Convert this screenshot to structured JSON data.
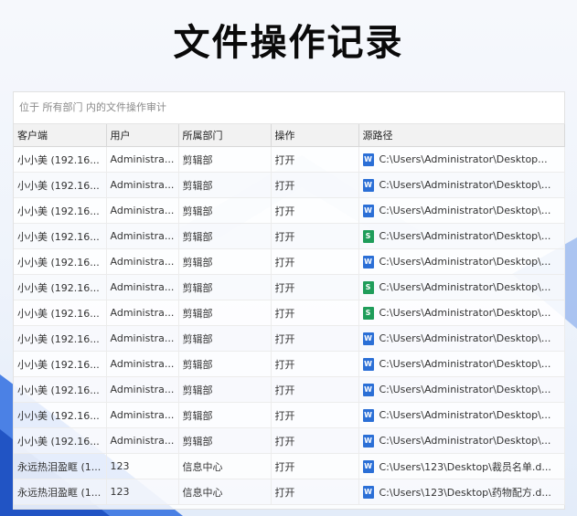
{
  "title": "文件操作记录",
  "audit": {
    "header_text": "位于 所有部门 内的文件操作审计"
  },
  "table": {
    "columns": [
      "客户端",
      "用户",
      "所属部门",
      "操作",
      "源路径"
    ],
    "rows": [
      {
        "client": "小小美 (192.16...",
        "user": "Administra...",
        "dept": "剪辑部",
        "op": "打开",
        "icon": "word-file-icon",
        "path": "C:\\Users\\Administrator\\Desktop..."
      },
      {
        "client": "小小美 (192.16...",
        "user": "Administra...",
        "dept": "剪辑部",
        "op": "打开",
        "icon": "word-file-icon",
        "path": "C:\\Users\\Administrator\\Desktop\\..."
      },
      {
        "client": "小小美 (192.16...",
        "user": "Administra...",
        "dept": "剪辑部",
        "op": "打开",
        "icon": "word-file-icon",
        "path": "C:\\Users\\Administrator\\Desktop\\..."
      },
      {
        "client": "小小美 (192.16...",
        "user": "Administra...",
        "dept": "剪辑部",
        "op": "打开",
        "icon": "spreadsheet-file-icon",
        "path": "C:\\Users\\Administrator\\Desktop\\..."
      },
      {
        "client": "小小美 (192.16...",
        "user": "Administra...",
        "dept": "剪辑部",
        "op": "打开",
        "icon": "word-file-icon",
        "path": "C:\\Users\\Administrator\\Desktop\\..."
      },
      {
        "client": "小小美 (192.16...",
        "user": "Administra...",
        "dept": "剪辑部",
        "op": "打开",
        "icon": "spreadsheet-file-icon",
        "path": "C:\\Users\\Administrator\\Desktop\\..."
      },
      {
        "client": "小小美 (192.16...",
        "user": "Administra...",
        "dept": "剪辑部",
        "op": "打开",
        "icon": "spreadsheet-file-icon",
        "path": "C:\\Users\\Administrator\\Desktop\\..."
      },
      {
        "client": "小小美 (192.16...",
        "user": "Administra...",
        "dept": "剪辑部",
        "op": "打开",
        "icon": "word-file-icon",
        "path": "C:\\Users\\Administrator\\Desktop\\..."
      },
      {
        "client": "小小美 (192.16...",
        "user": "Administra...",
        "dept": "剪辑部",
        "op": "打开",
        "icon": "word-file-icon",
        "path": "C:\\Users\\Administrator\\Desktop\\..."
      },
      {
        "client": "小小美 (192.16...",
        "user": "Administra...",
        "dept": "剪辑部",
        "op": "打开",
        "icon": "word-file-icon",
        "path": "C:\\Users\\Administrator\\Desktop\\..."
      },
      {
        "client": "小小美 (192.16...",
        "user": "Administra...",
        "dept": "剪辑部",
        "op": "打开",
        "icon": "word-file-icon",
        "path": "C:\\Users\\Administrator\\Desktop\\..."
      },
      {
        "client": "小小美 (192.16...",
        "user": "Administra...",
        "dept": "剪辑部",
        "op": "打开",
        "icon": "word-file-icon",
        "path": "C:\\Users\\Administrator\\Desktop\\..."
      },
      {
        "client": "永远热泪盈眶 (1...",
        "user": "123",
        "dept": "信息中心",
        "op": "打开",
        "icon": "word-file-icon",
        "path": "C:\\Users\\123\\Desktop\\裁员名单.d..."
      },
      {
        "client": "永远热泪盈眶 (1...",
        "user": "123",
        "dept": "信息中心",
        "op": "打开",
        "icon": "word-file-icon",
        "path": "C:\\Users\\123\\Desktop\\药物配方.d..."
      }
    ]
  },
  "colors": {
    "word_icon": "#2b6fd6",
    "spreadsheet_icon": "#1f9d5a"
  }
}
